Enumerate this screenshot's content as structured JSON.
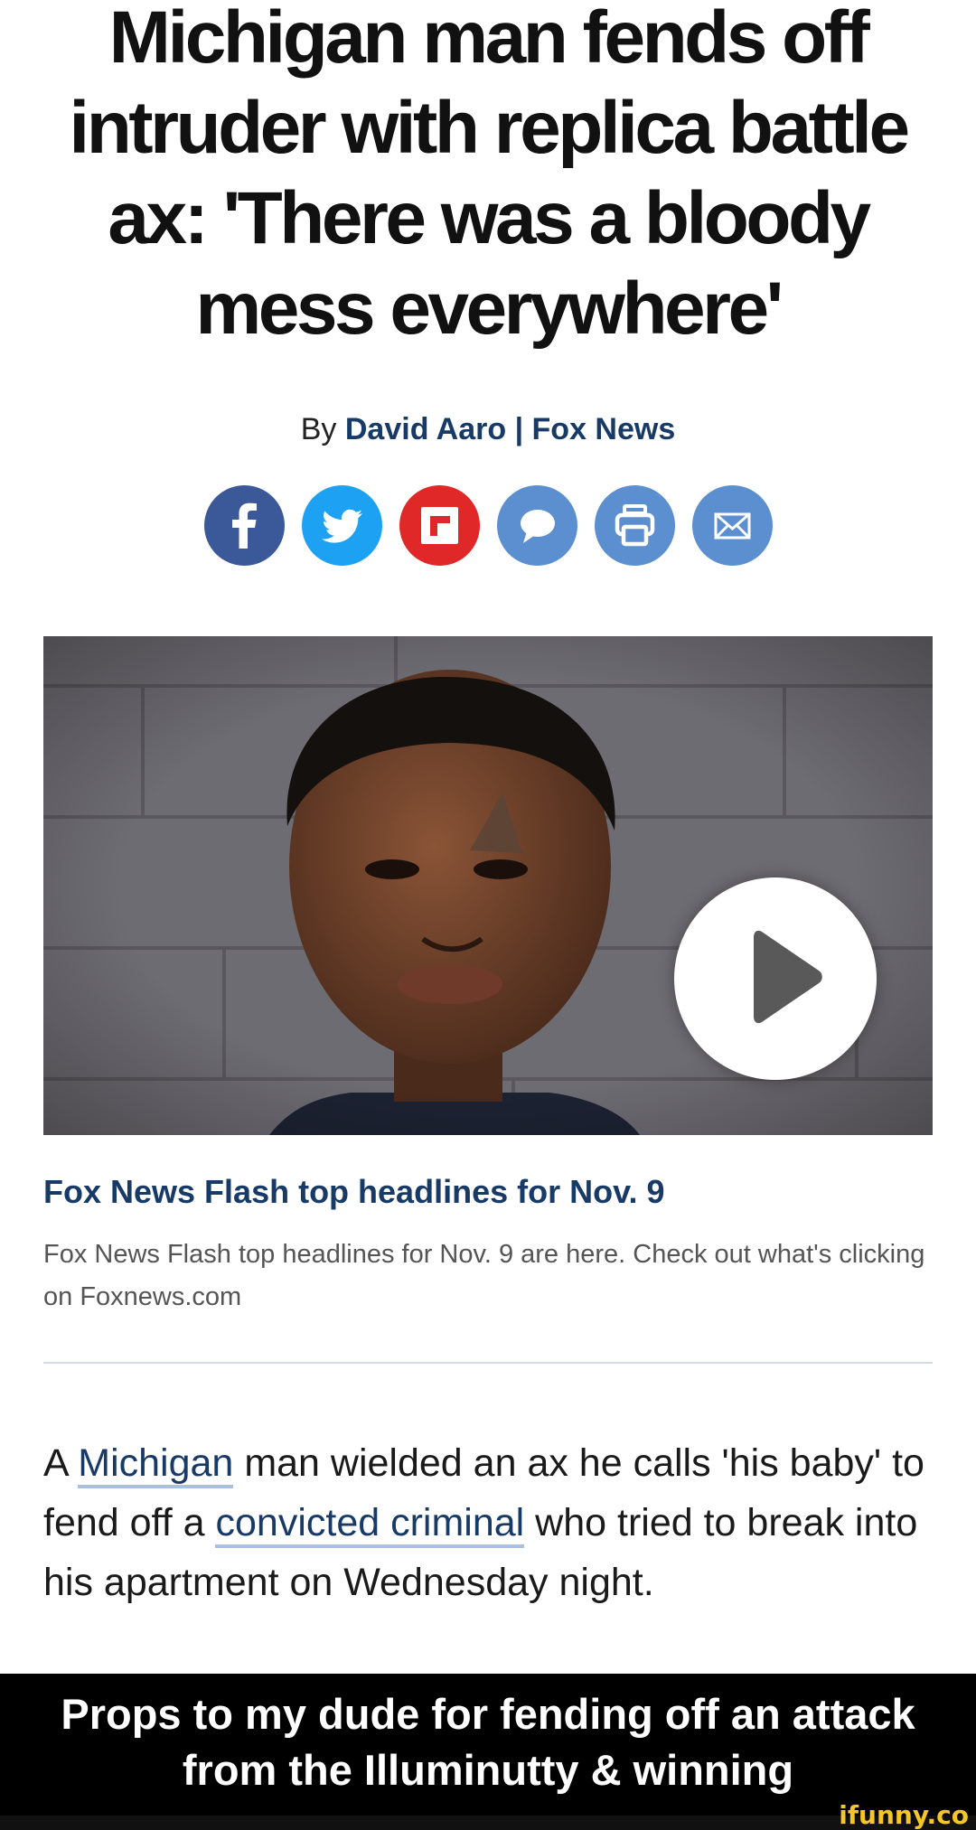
{
  "article": {
    "headline": "Michigan man fends off intruder with replica battle ax: 'There was a bloody mess everywhere'",
    "byline_prefix": "By",
    "author": "David Aaro",
    "byline_separator": "|",
    "source": "Fox News"
  },
  "share_buttons": [
    {
      "name": "facebook-share-button",
      "icon": "facebook-icon",
      "color": "#3b5998"
    },
    {
      "name": "twitter-share-button",
      "icon": "twitter-bird-icon",
      "color": "#1da1f2"
    },
    {
      "name": "flipboard-share-button",
      "icon": "flipboard-icon",
      "color": "#e12828"
    },
    {
      "name": "comments-button",
      "icon": "speech-bubble-icon",
      "color": "#5b8fd0"
    },
    {
      "name": "print-button",
      "icon": "printer-icon",
      "color": "#5b8fd0"
    },
    {
      "name": "email-button",
      "icon": "envelope-icon",
      "color": "#5b8fd0"
    }
  ],
  "video": {
    "play_icon": "play-icon",
    "title": "Fox News Flash top headlines for Nov. 9",
    "description": "Fox News Flash top headlines for Nov. 9 are here. Check out what's clicking on Foxnews.com"
  },
  "body": {
    "p1_start": "A",
    "link1": "Michigan",
    "p1_mid": "man wielded an ax he calls 'his baby' to fend off a",
    "link2": "convicted criminal",
    "p1_end": "who tried to break into his apartment on Wednesday night."
  },
  "caption": {
    "line1": "Props to my dude for fending off an attack",
    "line2": "from the Illuminutty & winning"
  },
  "watermark": "ifunny.co",
  "colors": {
    "brand_navy": "#183a67",
    "link_underline": "#a9c1dd",
    "watermark": "#f6c625"
  }
}
